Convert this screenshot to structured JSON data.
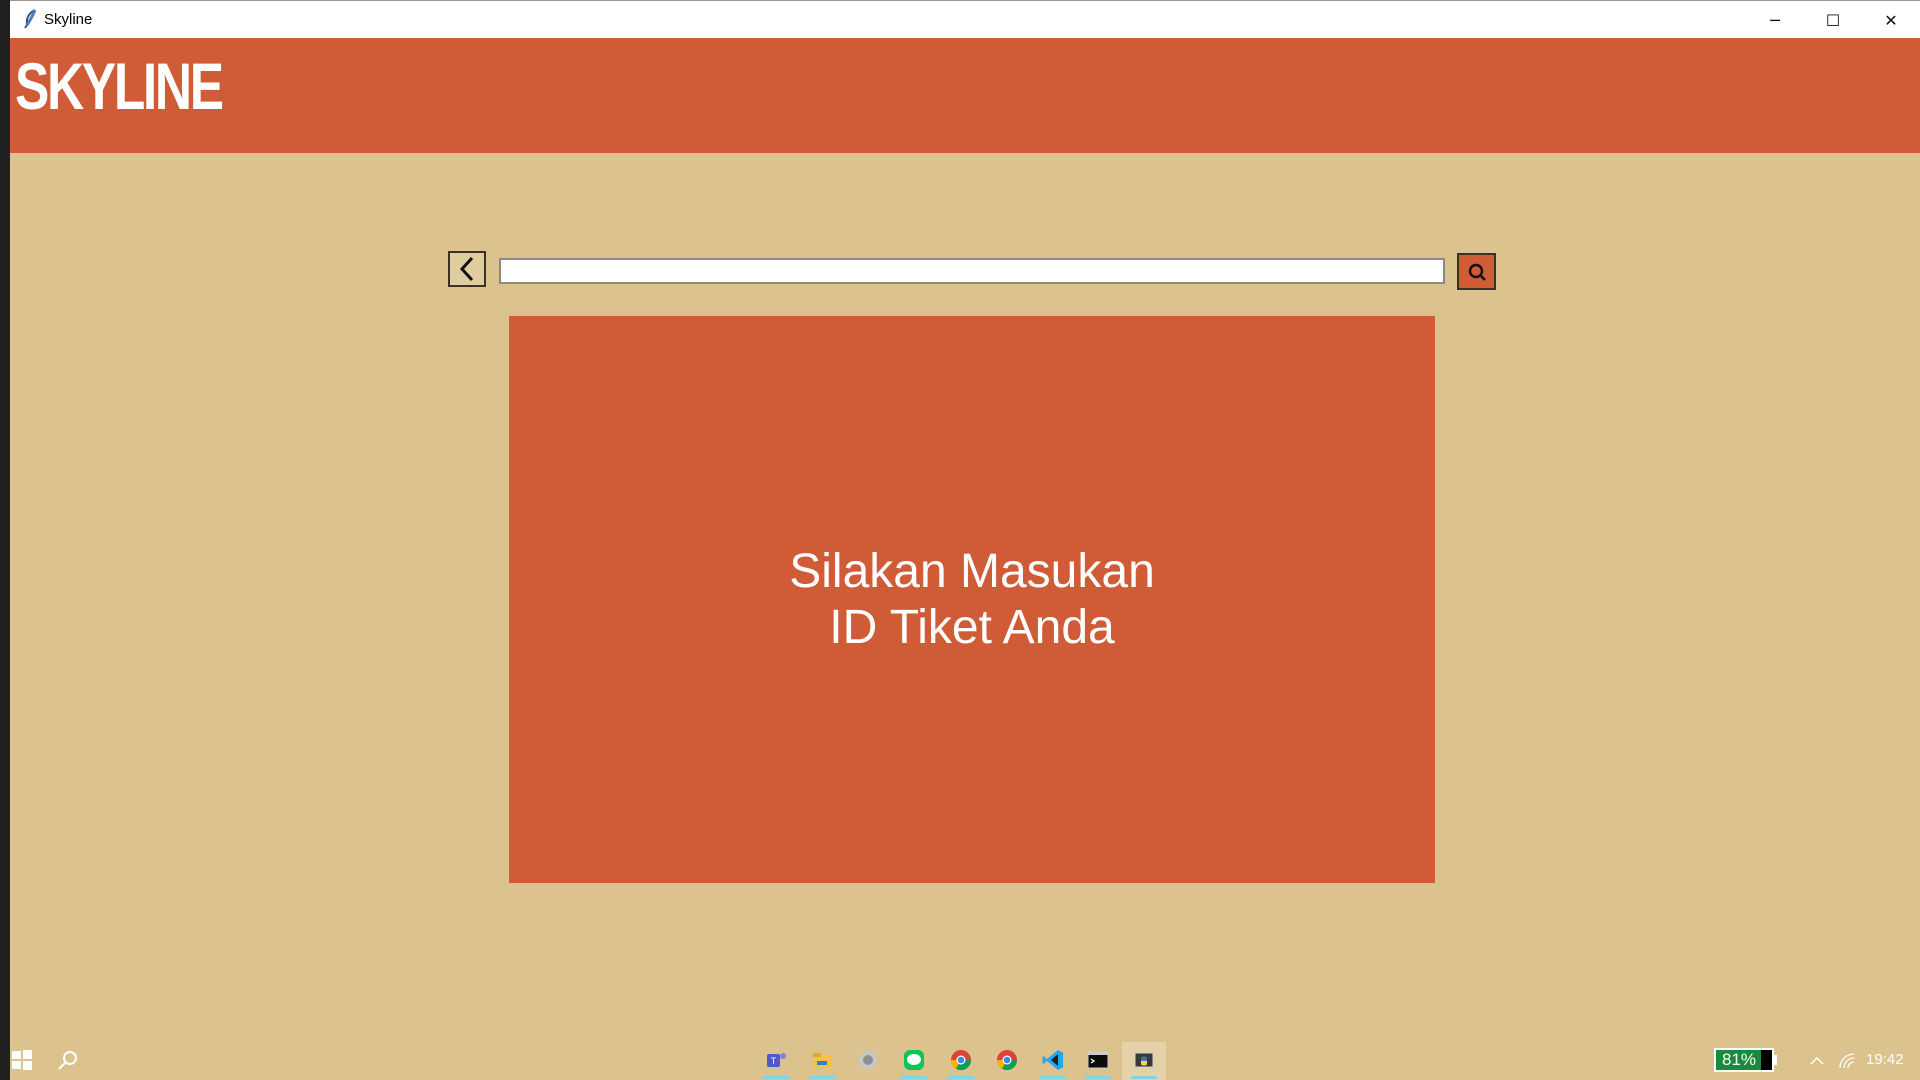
{
  "window": {
    "title": "Skyline",
    "controls": {
      "minimize": "─",
      "maximize": "☐",
      "close": "✕"
    }
  },
  "header": {
    "brand": "SKYLINE"
  },
  "search": {
    "value": "",
    "placeholder": "",
    "back_icon": "chevron-left-icon",
    "search_icon": "magnifier-icon"
  },
  "message": {
    "line1": "Silakan Masukan",
    "line2": "ID Tiket Anda"
  },
  "taskbar": {
    "apps": [
      "teams",
      "file-explorer",
      "app-circle",
      "line",
      "chrome",
      "chrome-profile",
      "vscode",
      "terminal",
      "python-idle"
    ],
    "battery_label": "81%",
    "battery_level": 0.81,
    "clock": "19:42"
  },
  "colors": {
    "accent": "#cf5b37",
    "background": "#dcc38d",
    "text_light": "#ffffff"
  }
}
